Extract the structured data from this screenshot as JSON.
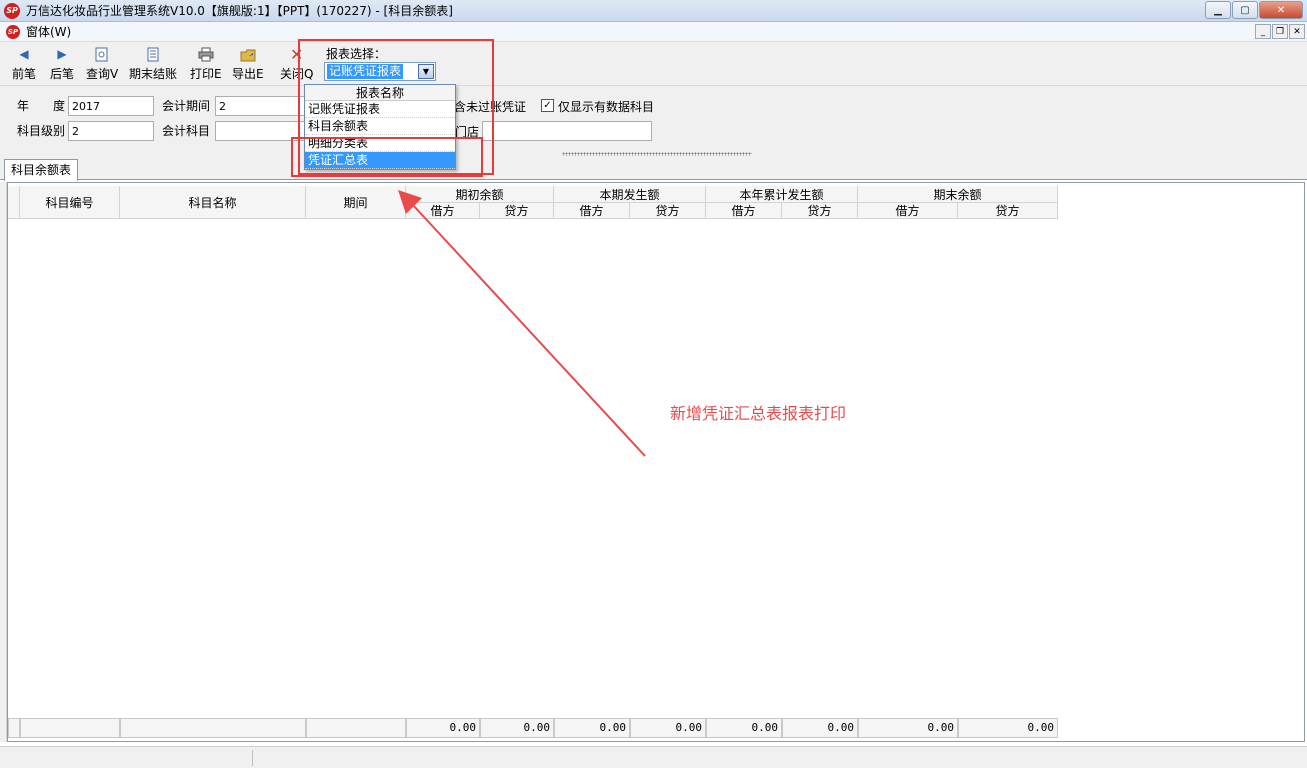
{
  "window": {
    "title": "万信达化妆品行业管理系统V10.0【旗舰版:1】【PPT】(170227) - [科目余额表]",
    "logo_icon": "app-logo-icon",
    "controls": [
      "minimize-icon",
      "maximize-icon",
      "close-icon"
    ]
  },
  "menubar": {
    "window_menu": "窗体(W)"
  },
  "toolbar": {
    "buttons": [
      {
        "label": "前笔",
        "icon": "arrow-left-icon"
      },
      {
        "label": "后笔",
        "icon": "arrow-right-icon"
      },
      {
        "label": "查询V",
        "icon": "query-icon"
      },
      {
        "label": "期末结账",
        "icon": "closing-icon"
      },
      {
        "label": "打印E",
        "icon": "printer-icon"
      },
      {
        "label": "导出E",
        "icon": "export-icon"
      },
      {
        "label": "关闭Q",
        "icon": "close-x-icon"
      }
    ],
    "report_select": {
      "label": "报表选择：",
      "value": "记账凭证报表"
    }
  },
  "dropdown": {
    "header": "报表名称",
    "items": [
      "记账凭证报表",
      "科目余额表",
      "明细分类表",
      "凭证汇总表"
    ],
    "selected_index": 3
  },
  "filters": {
    "year_label": "年　　度",
    "year_value": "2017",
    "period_label": "会计期间",
    "period_value": "2",
    "level_label": "科目级别",
    "level_value": "2",
    "subject_label": "会计科目",
    "subject_value": "",
    "unposted_label": "含未过账凭证",
    "data_only_label": "仅显示有数据科目",
    "data_only_checked": true,
    "store_label": "门店",
    "store_value": ""
  },
  "tabs": [
    {
      "label": "科目余额表"
    }
  ],
  "grid": {
    "columns": {
      "code": "科目编号",
      "name": "科目名称",
      "period": "期间",
      "opening": "期初余额",
      "current": "本期发生额",
      "ytd": "本年累计发生额",
      "closing": "期末余额",
      "debit": "借方",
      "credit": "贷方"
    },
    "totals": [
      "0.00",
      "0.00",
      "0.00",
      "0.00",
      "0.00",
      "0.00",
      "0.00",
      "0.00"
    ]
  },
  "annotation": {
    "text": "新增凭证汇总表报表打印"
  },
  "colors": {
    "highlight": "#3399ff",
    "annotation": "#e94b4b",
    "box": "#e83a3a"
  }
}
